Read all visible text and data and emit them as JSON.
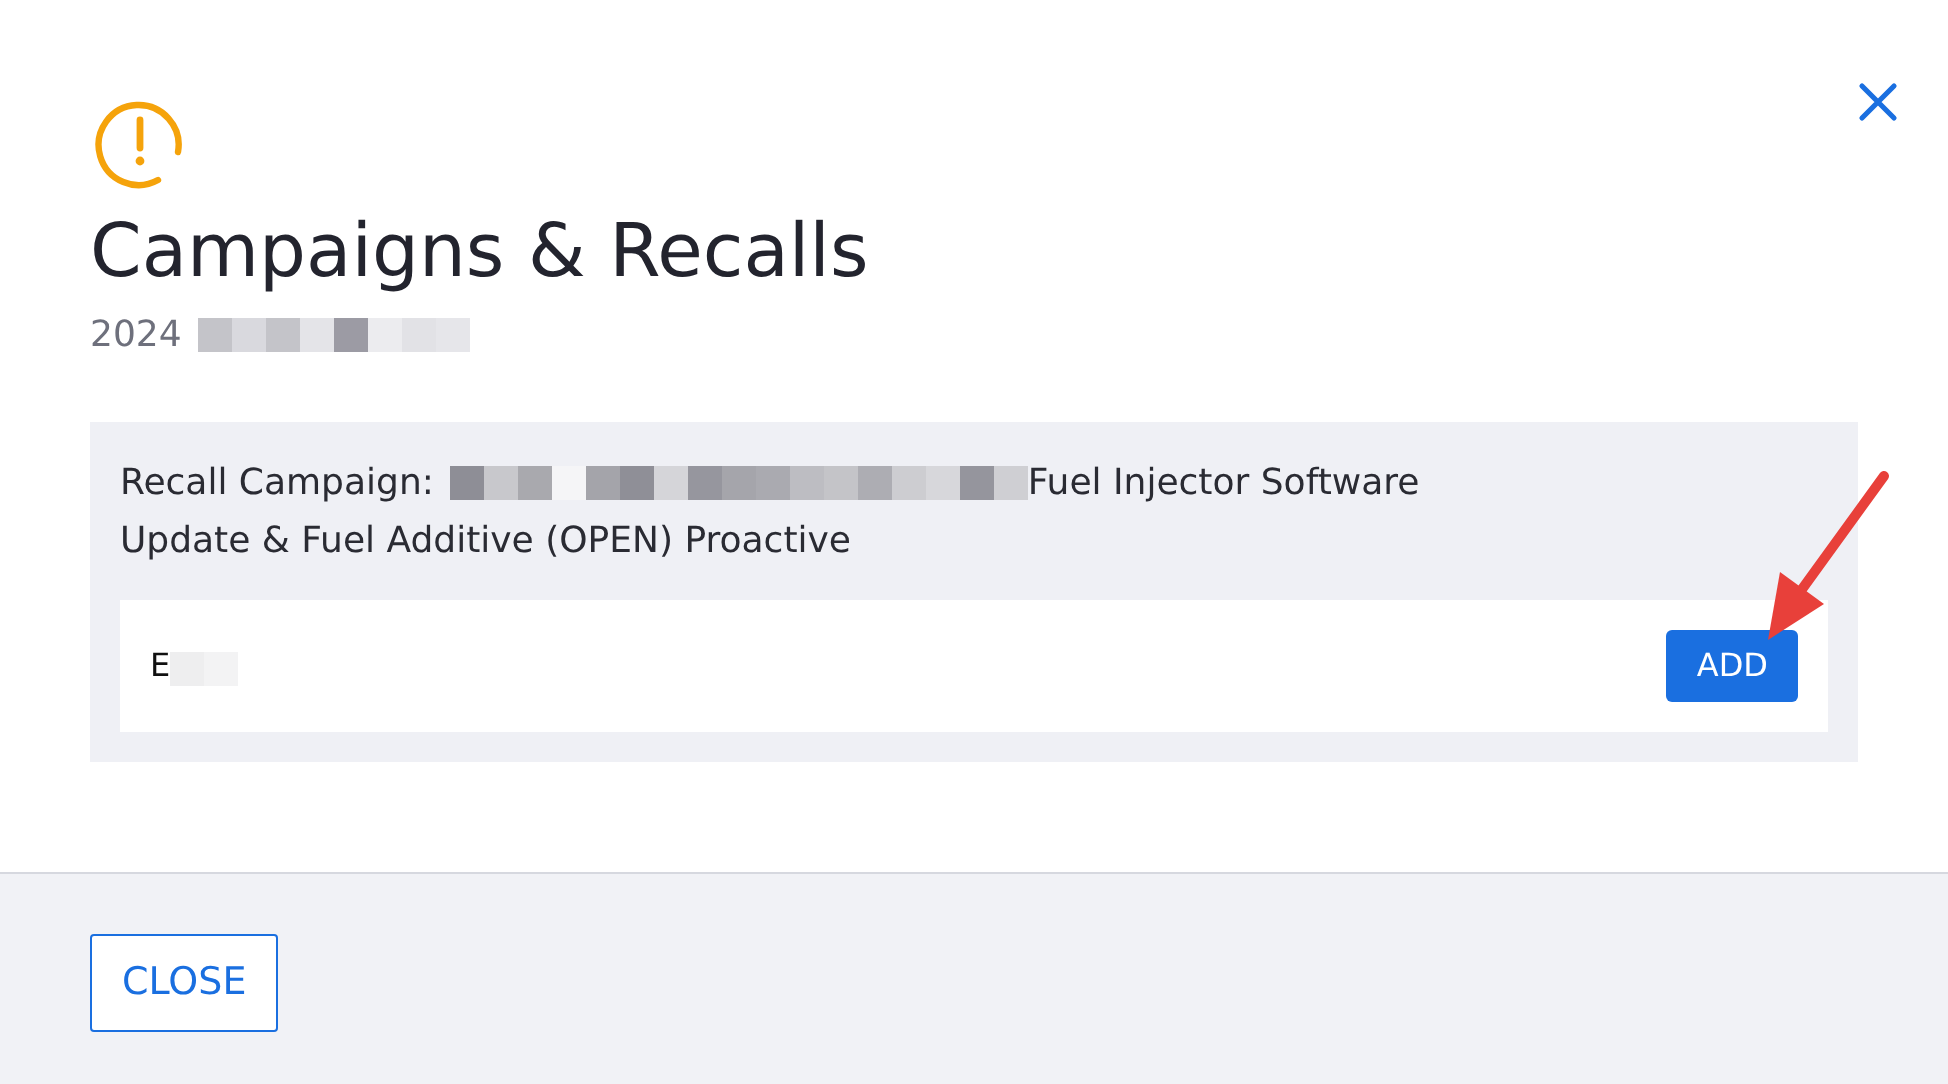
{
  "dialog": {
    "title": "Campaigns & Recalls",
    "subtitle": {
      "text": "2024",
      "redacted": true
    },
    "recall": {
      "label": "Recall Campaign:",
      "redacted": true,
      "title_lines": [
        "Fuel Injector Software",
        "Update & Fuel Additive (OPEN) Proactive"
      ]
    },
    "item": {
      "text": "E",
      "redacted": true,
      "button": "ADD"
    },
    "footer_button": "CLOSE"
  },
  "annotation_arrow": true
}
